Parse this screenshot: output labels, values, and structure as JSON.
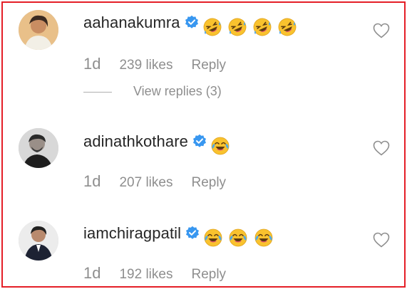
{
  "comments": [
    {
      "username": "aahanakumra",
      "verified": true,
      "emojis": [
        "rolling-on-floor-laughing",
        "rolling-on-floor-laughing",
        "rolling-on-floor-laughing",
        "rolling-on-floor-laughing"
      ],
      "age": "1d",
      "likes": "239 likes",
      "reply": "Reply",
      "view_replies": "View replies (3)"
    },
    {
      "username": "adinathkothare",
      "verified": true,
      "emojis": [
        "face-with-tears-of-joy"
      ],
      "age": "1d",
      "likes": "207 likes",
      "reply": "Reply"
    },
    {
      "username": "iamchiragpatil",
      "verified": true,
      "emojis": [
        "face-with-tears-of-joy",
        "face-with-tears-of-joy",
        "face-with-tears-of-joy"
      ],
      "age": "1d",
      "likes": "192 likes",
      "reply": "Reply"
    }
  ],
  "colors": {
    "frame_border": "#e41e26",
    "username_text": "#262626",
    "meta_text": "#8e8e8e",
    "verified_badge": "#3897f0",
    "emoji_yellow": "#f9c22e"
  }
}
